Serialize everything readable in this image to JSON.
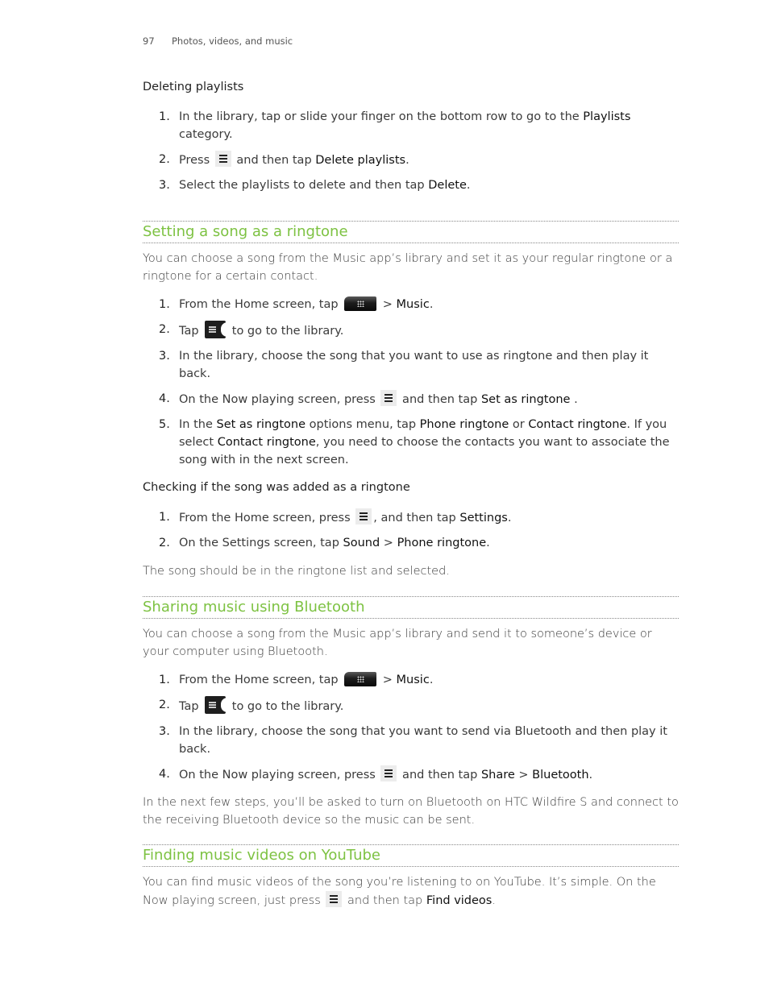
{
  "header": {
    "page_number": "97",
    "chapter": "Photos, videos, and music"
  },
  "icons": {
    "menu_key": "menu-key-icon",
    "all_apps": "all-apps-icon",
    "library": "library-icon"
  },
  "colors": {
    "section_title": "#7dc242",
    "text": "#3b3b3b"
  },
  "deleting": {
    "title": "Deleting playlists",
    "steps": [
      {
        "n": "1.",
        "t1": "In the library, tap or slide your finger on the bottom row to go to the ",
        "b1": "Playlists",
        "t2": " category."
      },
      {
        "n": "2.",
        "t1": "Press ",
        "t2": " and then tap ",
        "b1": "Delete playlists",
        "t3": "."
      },
      {
        "n": "3.",
        "t1": "Select the playlists to delete and then tap ",
        "b1": "Delete",
        "t2": "."
      }
    ]
  },
  "ringtone": {
    "title": "Setting a song as a ringtone",
    "intro": "You can choose a song from the Music app’s library and set it as your regular ringtone or a ringtone for a certain contact.",
    "steps": [
      {
        "n": "1.",
        "t1": "From the Home screen, tap ",
        "t2": " > ",
        "b1": "Music",
        "t3": "."
      },
      {
        "n": "2.",
        "t1": "Tap ",
        "t2": " to go to the library."
      },
      {
        "n": "3.",
        "t1": "In the library, choose the song that you want to use as ringtone and then play it back."
      },
      {
        "n": "4.",
        "t1": "On the Now playing screen, press ",
        "t2": " and then tap ",
        "b1": "Set as ringtone",
        "t3": " ."
      },
      {
        "n": "5.",
        "t1": "In the ",
        "b1": "Set as ringtone",
        "t2": " options menu, tap ",
        "b2": "Phone ringtone",
        "t3": " or ",
        "b3": "Contact ringtone",
        "t4": ". If you select ",
        "b4": "Contact ringtone",
        "t5": ", you need to choose the contacts you want to associate the song with in the next screen."
      }
    ],
    "check_title": "Checking if the song was added as a ringtone",
    "check_steps": [
      {
        "n": "1.",
        "t1": "From the Home screen, press ",
        "t2": ", and then tap ",
        "b1": "Settings",
        "t3": "."
      },
      {
        "n": "2.",
        "t1": "On the Settings screen, tap ",
        "b1": "Sound",
        "t2": " > ",
        "b2": "Phone ringtone",
        "t3": "."
      }
    ],
    "outro": "The song should be in the ringtone list and selected."
  },
  "bluetooth": {
    "title": "Sharing music using Bluetooth",
    "intro": "You can choose a song from the Music app’s library and send it to someone’s device or your computer using Bluetooth.",
    "steps": [
      {
        "n": "1.",
        "t1": "From the Home screen, tap ",
        "t2": " > ",
        "b1": "Music",
        "t3": "."
      },
      {
        "n": "2.",
        "t1": "Tap ",
        "t2": " to go to the library."
      },
      {
        "n": "3.",
        "t1": "In the library, choose the song that you want to send via Bluetooth and then play it back."
      },
      {
        "n": "4.",
        "t1": "On the Now playing screen, press ",
        "t2": " and then tap ",
        "b1": "Share",
        "t3": " > ",
        "b2": "Bluetooth",
        "t4": "."
      }
    ],
    "outro": "In the next few steps, you’ll be asked to turn on Bluetooth on HTC Wildfire S and connect to the receiving Bluetooth device so the music can be sent."
  },
  "youtube": {
    "title": "Finding music videos on YouTube",
    "t1": "You can find music videos of the song you’re listening to on YouTube. It’s simple. On the Now playing screen, just press ",
    "t2": " and then tap ",
    "b1": "Find videos",
    "t3": "."
  }
}
